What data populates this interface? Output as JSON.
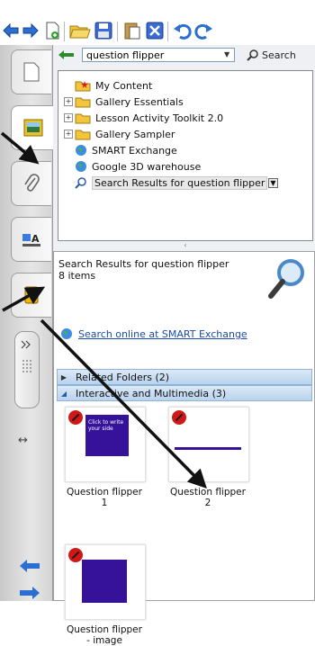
{
  "search": {
    "value": "question flipper",
    "button": "Search"
  },
  "tree": [
    "My Content",
    "Gallery Essentials",
    "Lesson Activity Toolkit 2.0",
    "Gallery Sampler",
    "SMART Exchange",
    "Google 3D warehouse",
    "Search Results for question flipper"
  ],
  "results": {
    "title": "Search Results for question flipper",
    "count": "8 items",
    "online_link": "Search online at SMART Exchange",
    "groups": [
      "Related Folders (2)",
      "Interactive and Multimedia (3)"
    ],
    "items": [
      {
        "caption1": "Question flipper",
        "caption2": "1",
        "card_text": "Click to write your side"
      },
      {
        "caption1": "Question flipper",
        "caption2": "2"
      },
      {
        "caption1": "Question flipper",
        "caption2": "- image"
      }
    ]
  },
  "colors": {
    "accent_blue": "#1e62c9",
    "item_purple": "#36119a",
    "link": "#1a4ab4"
  }
}
